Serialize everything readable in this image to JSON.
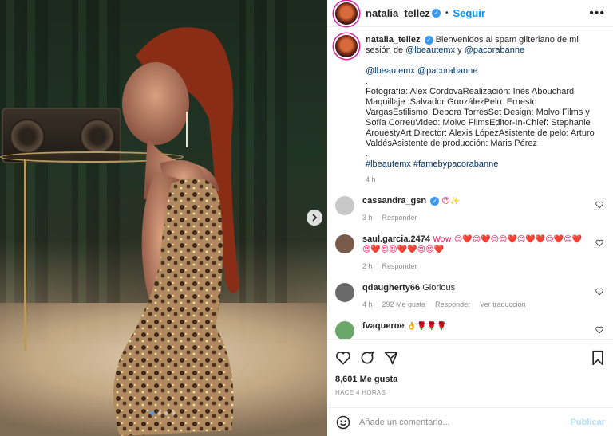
{
  "post": {
    "username": "natalia_tellez",
    "follow_label": "Seguir",
    "more_label": "•••",
    "caption_intro": "Bienvenidos al spam gliteriano de mi sesión de",
    "caption_mentions_1": "@lbeautemx",
    "caption_connector": "y",
    "caption_mentions_2": "@pacorabanne",
    "caption_mentions_line": "@lbeautemx @pacorabanne",
    "caption_dot_1": ".",
    "caption_credits": "Fotografía: Alex CordovaRealización: Inés Abouchard Maquillaje: Salvador GonzálezPelo: Ernesto VargasEstilismo: Debora TorresSet Design: Molvo Films y Sofía CorreuVideo: Molvo FilmsEditor-In-Chief: Stephanie ArouestyArt Director: Alexis LópezAsistente de pelo: Arturo ValdésAsistente de producción: Maris Pérez",
    "caption_dot_2": ".",
    "caption_hashtags": "#lbeautemx #famebypacorabanne",
    "caption_time": "4 h"
  },
  "comments": [
    {
      "user": "cassandra_gsn",
      "verified": true,
      "text": "😍✨",
      "time": "3 h",
      "reply": "Responder",
      "avatar_color": "#c8c8c8"
    },
    {
      "user": "saul.garcia.2474",
      "verified": false,
      "text": "Wow 😍❤️😍❤️😍😍❤️😍❤️❤️😍❤️😍❤️😍❤️😍😍❤️❤️😍😍❤️",
      "time": "2 h",
      "reply": "Responder",
      "avatar_color": "#7a5a4a"
    },
    {
      "user": "qdaugherty66",
      "verified": false,
      "text": "Glorious",
      "time": "4 h",
      "likes": "292 Me gusta",
      "reply": "Responder",
      "translate": "Ver traducción",
      "avatar_color": "#6a6a6a"
    },
    {
      "user": "fvaqueroe",
      "verified": false,
      "text": "👌🌹🌹🌹",
      "time": "",
      "reply": "",
      "avatar_color": "#6aa86a"
    }
  ],
  "actions": {
    "likes": "8,601 Me gusta",
    "posted": "HACE 4 HORAS"
  },
  "composer": {
    "placeholder": "Añade un comentario...",
    "publish": "Publicar"
  },
  "carousel": {
    "total": 4,
    "current": 1
  },
  "colors": {
    "link": "#00376b",
    "accent": "#0095f6",
    "verified": "#3897f0"
  }
}
